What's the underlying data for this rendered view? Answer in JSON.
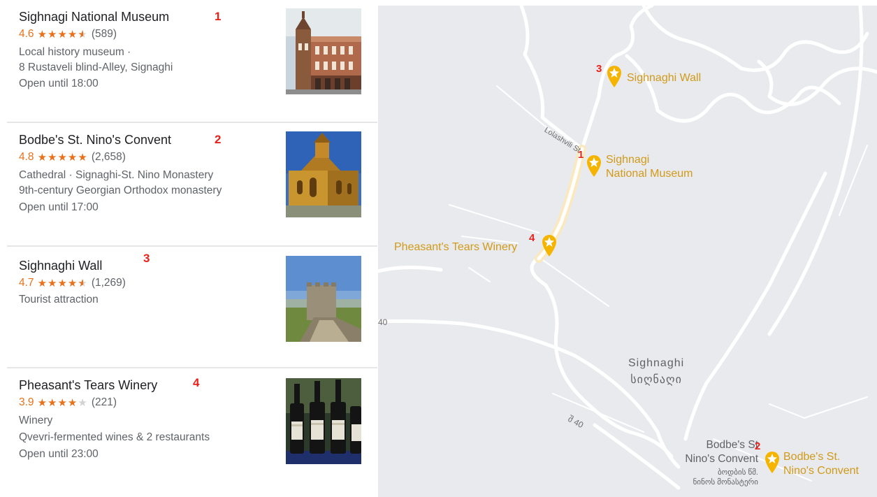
{
  "results": [
    {
      "name": "Sighnagi National Museum",
      "marker": "1",
      "score": "4.6",
      "stars": 4.5,
      "reviews": "(589)",
      "lines": [
        "Local history museum ·",
        "8 Rustaveli blind-Alley, Signaghi",
        "Open until 18:00"
      ],
      "image": "museum-building-photo"
    },
    {
      "name": "Bodbe's St. Nino's Convent",
      "marker": "2",
      "score": "4.8",
      "stars": 5,
      "reviews": "(2,658)",
      "lines": [
        "Cathedral · Signaghi-St. Nino Monastery",
        "9th-century Georgian Orthodox monastery",
        "Open until 17:00"
      ],
      "image": "convent-photo"
    },
    {
      "name": "Sighnaghi Wall",
      "marker": "3",
      "score": "4.7",
      "stars": 4.5,
      "reviews": "(1,269)",
      "lines": [
        "Tourist attraction"
      ],
      "image": "wall-photo"
    },
    {
      "name": "Pheasant's Tears Winery",
      "marker": "4",
      "score": "3.9",
      "stars": 4,
      "reviews": "(221)",
      "lines": [
        "Winery",
        "Qvevri-fermented wines & 2 restaurants",
        "Open until 23:00"
      ],
      "image": "wine-bottles-photo"
    }
  ],
  "map": {
    "pois": [
      {
        "label_line1": "Sighnaghi Wall",
        "label_line2": "",
        "marker": "3"
      },
      {
        "label_line1": "Sighnagi",
        "label_line2": "National Museum",
        "marker": "1"
      },
      {
        "label_line1": "Pheasant's Tears Winery",
        "label_line2": "",
        "marker": "4"
      },
      {
        "label_line1": "Bodbe's St.",
        "label_line2": "Nino's Convent",
        "marker": "2"
      }
    ],
    "town_name": "Sighnaghi",
    "town_name_ka": "სიღნაღი",
    "street_name": "Lolashvili St",
    "road_label_1": "40",
    "road_label_2": "შ 40",
    "convent_grey_1": "Bodbe's St",
    "convent_grey_2": "Nino's Convent",
    "convent_ka_1": "ბოდბის წმ.",
    "convent_ka_2": "ნინოს მონასტერი",
    "pin_color": "#f4b400",
    "road_color": "#ffffff",
    "highlight_road_color": "#fbe9bd"
  },
  "colors": {
    "rating": "#e8711c",
    "marker_number": "#e8221b",
    "poi_label": "#d19a19",
    "map_bg": "#e8eaed"
  }
}
